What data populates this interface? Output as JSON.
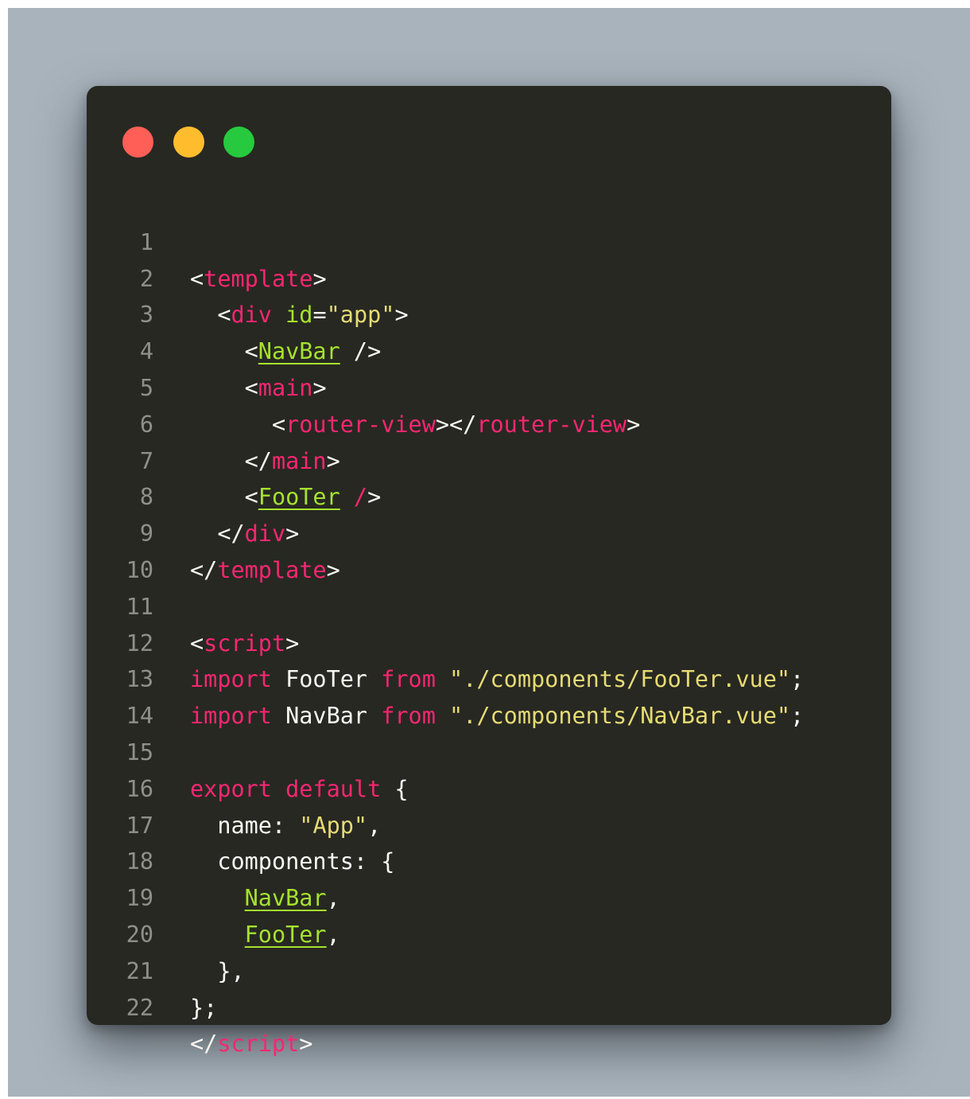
{
  "window": {
    "controls": {
      "close_color": "#ff5f56",
      "minimize_color": "#ffbd2e",
      "maximize_color": "#27c93f"
    }
  },
  "colors": {
    "background": "#272822",
    "foreground": "#f8f8f2",
    "tag": "#f92672",
    "attribute": "#a6e22e",
    "string": "#e6db74",
    "line_number": "#8f908a"
  },
  "code": {
    "language": "vue",
    "lines": [
      {
        "n": "1",
        "t": [
          "<",
          "template",
          ">"
        ]
      },
      {
        "n": "2",
        "t": [
          "  <",
          "div",
          " ",
          "id",
          "=",
          "\"app\"",
          ">"
        ]
      },
      {
        "n": "3",
        "t": [
          "    <",
          "NavBar",
          " />"
        ]
      },
      {
        "n": "4",
        "t": [
          "    <",
          "main",
          ">"
        ]
      },
      {
        "n": "5",
        "t": [
          "      <",
          "router-view",
          "></",
          "router-view",
          ">"
        ]
      },
      {
        "n": "6",
        "t": [
          "    </",
          "main",
          ">"
        ]
      },
      {
        "n": "7",
        "t": [
          "    <",
          "FooTer",
          " ",
          "/",
          ">"
        ]
      },
      {
        "n": "8",
        "t": [
          "  </",
          "div",
          ">"
        ]
      },
      {
        "n": "9",
        "t": [
          "</",
          "template",
          ">"
        ]
      },
      {
        "n": "10",
        "t": [
          ""
        ]
      },
      {
        "n": "11",
        "t": [
          "<",
          "script",
          ">"
        ]
      },
      {
        "n": "12",
        "t": [
          "import",
          " FooTer ",
          "from",
          " ",
          "\"./components/FooTer.vue\"",
          ";"
        ]
      },
      {
        "n": "13",
        "t": [
          "import",
          " NavBar ",
          "from",
          " ",
          "\"./components/NavBar.vue\"",
          ";"
        ]
      },
      {
        "n": "14",
        "t": [
          ""
        ]
      },
      {
        "n": "15",
        "t": [
          "export",
          " ",
          "default",
          " {"
        ]
      },
      {
        "n": "16",
        "t": [
          "  name: ",
          "\"App\"",
          ","
        ]
      },
      {
        "n": "17",
        "t": [
          "  components: {"
        ]
      },
      {
        "n": "18",
        "t": [
          "    ",
          "NavBar",
          ","
        ]
      },
      {
        "n": "19",
        "t": [
          "    ",
          "FooTer",
          ","
        ]
      },
      {
        "n": "20",
        "t": [
          "  },"
        ]
      },
      {
        "n": "21",
        "t": [
          "};"
        ]
      },
      {
        "n": "22",
        "t": [
          "</",
          "script",
          ">"
        ]
      }
    ]
  }
}
